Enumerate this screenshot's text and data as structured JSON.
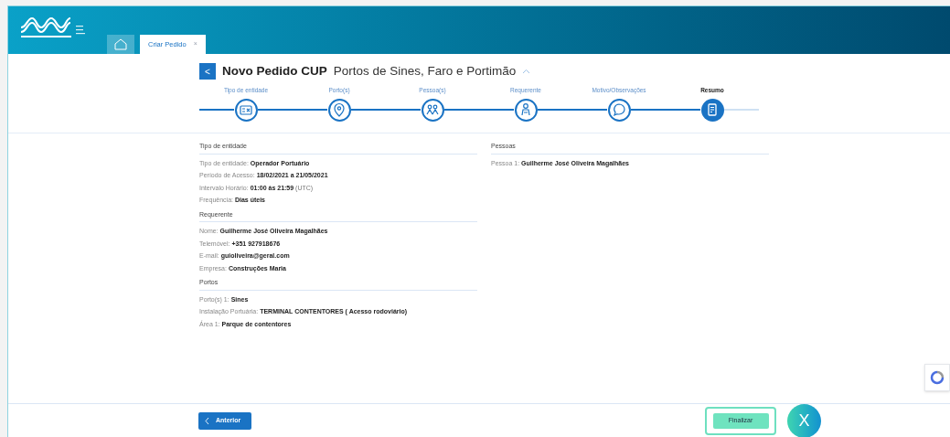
{
  "tabs": [
    {
      "kind": "home",
      "selected": false
    },
    {
      "kind": "text",
      "label": "Criar Pedido",
      "close": "×",
      "selected": true
    }
  ],
  "header": {
    "back": "<",
    "title": "Novo Pedido CUP",
    "subtitle": "Portos de Sines, Faro e Portimão"
  },
  "steps": [
    {
      "label": "Tipo de entidade",
      "kind": "id",
      "selected": false
    },
    {
      "label": "Porto(s)",
      "kind": "pin",
      "selected": false
    },
    {
      "label": "Pessoa(s)",
      "kind": "people",
      "selected": false
    },
    {
      "label": "Requerente",
      "kind": "person",
      "selected": false
    },
    {
      "label": "Motivo/Observações",
      "kind": "chat",
      "selected": false
    },
    {
      "label": "Resumo",
      "kind": "doc",
      "selected": true
    }
  ],
  "columns": [
    [
      {
        "title": "Tipo de entidade",
        "fields": [
          {
            "label": "Tipo de entidade:",
            "value": "Operador Portuário"
          },
          {
            "label": "Período de Acesso:",
            "value": "18/02/2021 a 21/05/2021"
          },
          {
            "label": "Intervalo Horário:",
            "value": "01:00 às 21:59",
            "note": "(UTC)"
          },
          {
            "label": "Frequência:",
            "value": "Dias úteis"
          }
        ]
      },
      {
        "title": "Requerente",
        "fields": [
          {
            "label": "Nome:",
            "value": "Guilherme José Oliveira Magalhães"
          },
          {
            "label": "Telemóvel:",
            "value": "+351 927918676"
          },
          {
            "label": "E-mail:",
            "value": "guioliveira@geral.com"
          },
          {
            "label": "Empresa:",
            "value": "Construções Maria"
          }
        ]
      },
      {
        "title": "Portos",
        "fields": [
          {
            "label": "Porto(s) 1:",
            "value": "Sines"
          },
          {
            "label": "Instalação Portuária:",
            "value": "TERMINAL CONTENTORES ( Acesso rodoviário)"
          },
          {
            "label": "Área 1:",
            "value": "Parque de contentores"
          }
        ]
      }
    ],
    [
      {
        "title": "Pessoas",
        "fields": [
          {
            "label": "Pessoa 1:",
            "value": "Guilherme José Oliveira Magalhães"
          }
        ]
      }
    ]
  ],
  "footer": {
    "previous": "Anterior",
    "finish": "Finalizar",
    "fab": "X"
  }
}
